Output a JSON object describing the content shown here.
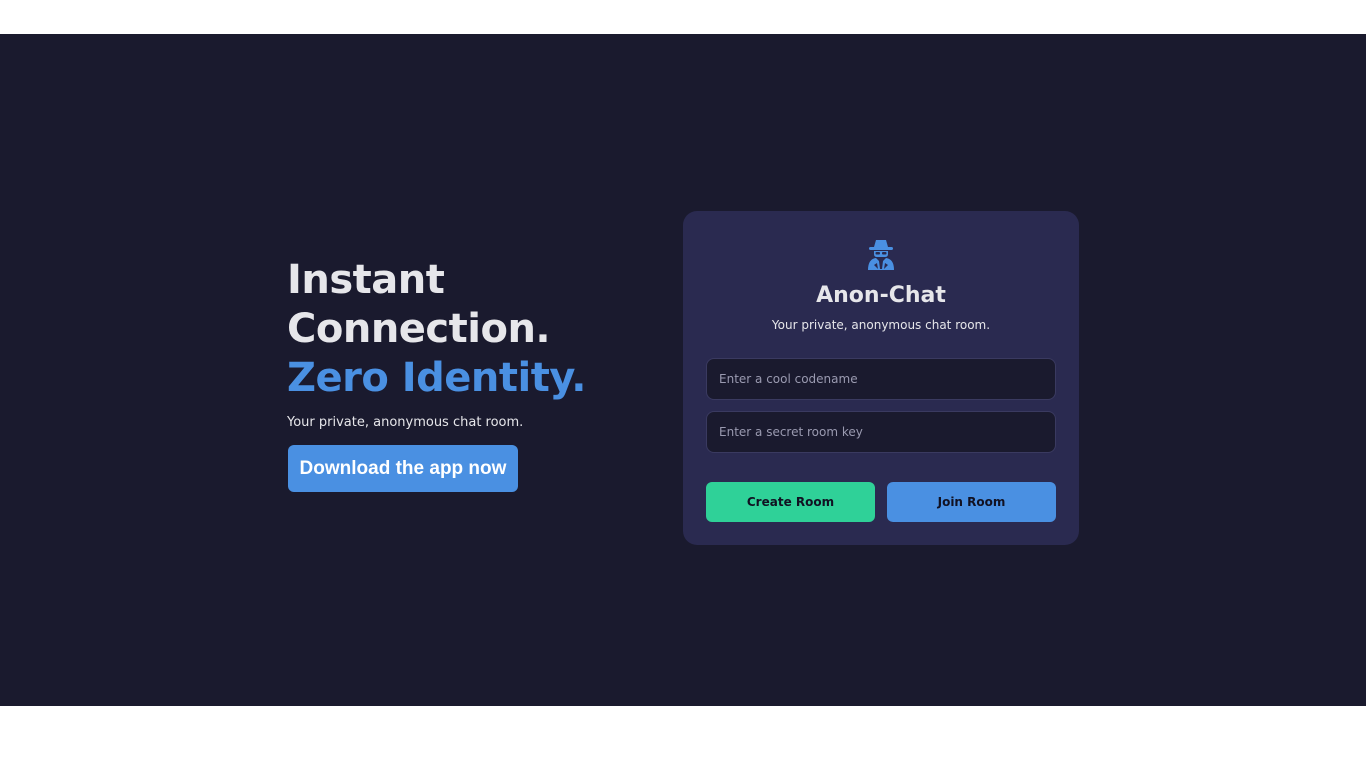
{
  "hero": {
    "title_line1": "Instant",
    "title_line2": "Connection.",
    "title_accent": "Zero Identity.",
    "subtitle": "Your private, anonymous chat room.",
    "download_label": "Download the app now"
  },
  "card": {
    "icon": "user-secret-icon",
    "title": "Anon-Chat",
    "subtitle": "Your private, anonymous chat room.",
    "codename_placeholder": "Enter a cool codename",
    "codename_value": "",
    "roomkey_placeholder": "Enter a secret room key",
    "roomkey_value": "",
    "create_label": "Create Room",
    "join_label": "Join Room"
  },
  "colors": {
    "background": "#1a1a2e",
    "card": "#2a2a50",
    "accent_blue": "#4a90e2",
    "accent_green": "#2fd198",
    "text": "#e6e6ea"
  }
}
